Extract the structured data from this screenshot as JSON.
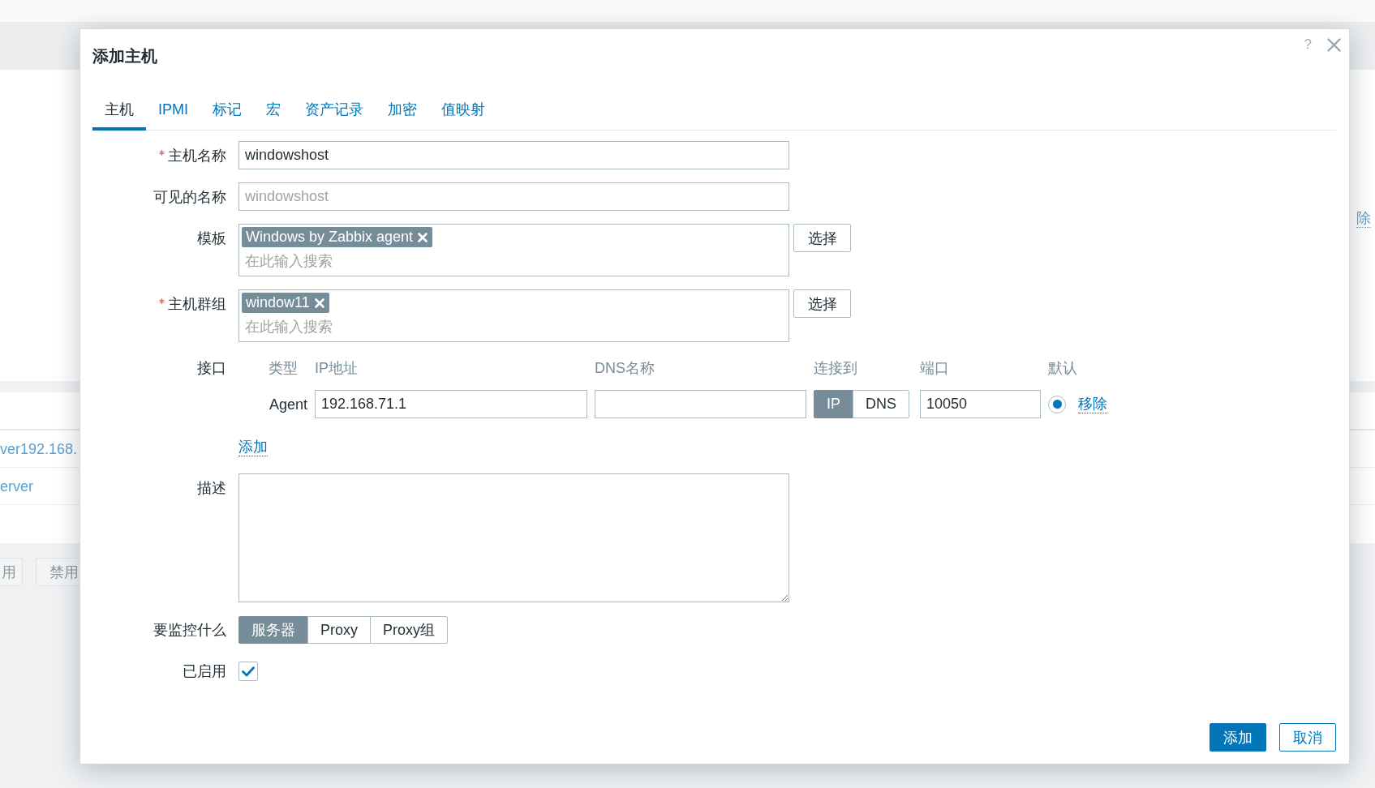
{
  "background": {
    "side_link": "除",
    "rows": [
      "ver192.168.",
      "erver"
    ],
    "buttons": [
      "用",
      "禁用"
    ]
  },
  "dialog": {
    "title": "添加主机",
    "help": "?",
    "tabs": [
      {
        "label": "主机",
        "selected": true
      },
      {
        "label": "IPMI",
        "selected": false
      },
      {
        "label": "标记",
        "selected": false
      },
      {
        "label": "宏",
        "selected": false
      },
      {
        "label": "资产记录",
        "selected": false
      },
      {
        "label": "加密",
        "selected": false
      },
      {
        "label": "值映射",
        "selected": false
      }
    ],
    "rows": [
      {
        "kind": "text",
        "label": "主机名称",
        "required": true,
        "value": "windowshost"
      },
      {
        "kind": "text",
        "label": "可见的名称",
        "placeholder": "windowshost"
      },
      {
        "kind": "multiselect",
        "label": "模板",
        "tags": [
          "Windows by Zabbix agent"
        ],
        "placeholder": "在此输入搜索",
        "button": "选择"
      },
      {
        "kind": "multiselect",
        "label": "主机群组",
        "required": true,
        "tags": [
          "window11"
        ],
        "placeholder": "在此输入搜索",
        "button": "选择"
      },
      {
        "kind": "interfaces",
        "label": "接口",
        "columns": [
          "类型",
          "IP地址",
          "DNS名称",
          "连接到",
          "端口",
          "默认"
        ],
        "interfaces": [
          {
            "type": "Agent",
            "ip": "192.168.71.1",
            "connect": [
              {
                "label": "IP",
                "selected": true
              },
              {
                "label": "DNS",
                "selected": false
              }
            ],
            "port": "10050",
            "default": true,
            "remove": "移除"
          }
        ],
        "add": "添加"
      },
      {
        "kind": "textarea",
        "label": "描述"
      },
      {
        "kind": "segmented",
        "label": "要监控什么",
        "options": [
          {
            "label": "服务器",
            "selected": true
          },
          {
            "label": "Proxy",
            "selected": false
          },
          {
            "label": "Proxy组",
            "selected": false
          }
        ]
      },
      {
        "kind": "checkbox",
        "label": "已启用",
        "checked": true
      }
    ],
    "buttons": [
      {
        "label": "添加",
        "kind": "primary"
      },
      {
        "label": "取消",
        "kind": "secondary"
      }
    ]
  }
}
